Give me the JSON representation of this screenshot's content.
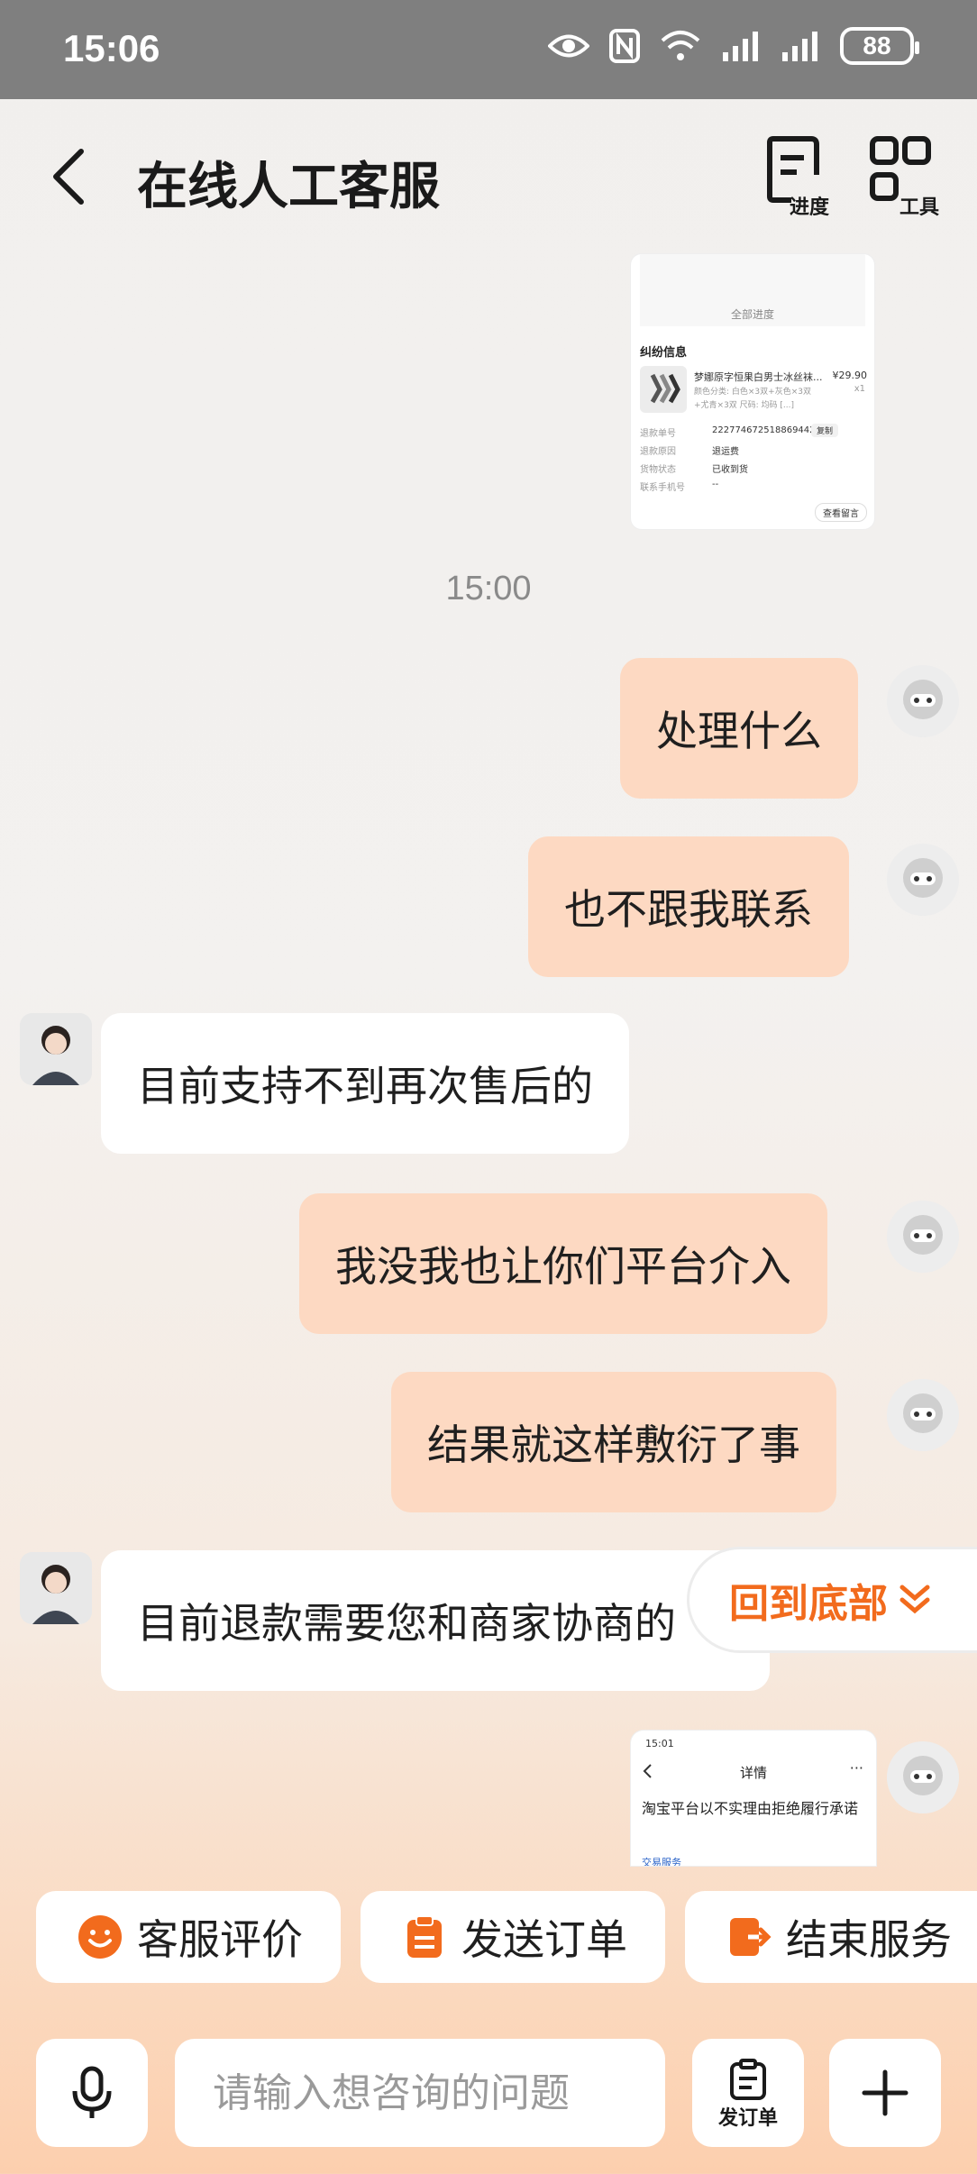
{
  "status_bar": {
    "time": "15:06",
    "battery": "88"
  },
  "header": {
    "title": "在线人工客服",
    "progress_label": "进度",
    "tools_label": "工具"
  },
  "chat": {
    "card1": {
      "all_progress": "全部进度",
      "title": "纠纷信息",
      "product": "梦娜原字恒果白男士冰丝袜...",
      "price": "¥29.90",
      "qty": "x1",
      "variant": "颜色分类: 白色×3双+灰色×3双+尤青×3双 尺码: 均码 [...]",
      "order_no_label": "退款单号",
      "order_no": "2227746725188694421",
      "copy": "复制",
      "reason_label": "退款原因",
      "reason": "退运费",
      "status_label": "货物状态",
      "status": "已收到货",
      "phone_label": "联系手机号",
      "phone": "--",
      "view_msg": "查看留言"
    },
    "time_label": "15:00",
    "messages": [
      {
        "side": "me",
        "text": "处理什么"
      },
      {
        "side": "me",
        "text": "也不跟我联系"
      },
      {
        "side": "them",
        "text": "目前支持不到再次售后的"
      },
      {
        "side": "me",
        "text": "我没我也让你们平台介入"
      },
      {
        "side": "me",
        "text": "结果就这样敷衍了事"
      },
      {
        "side": "them",
        "text": "目前退款需要您和商家协商的"
      }
    ],
    "card2": {
      "time": "15:01",
      "header": "详情",
      "body": "淘宝平台以不实理由拒绝履行承诺",
      "footer": "交易服务"
    }
  },
  "back_to_bottom": "回到底部",
  "quick_actions": [
    {
      "label": "客服评价",
      "icon": "smile-icon"
    },
    {
      "label": "发送订单",
      "icon": "clipboard-icon"
    },
    {
      "label": "结束服务",
      "icon": "exit-icon"
    }
  ],
  "input": {
    "placeholder": "请输入想咨询的问题",
    "order_label": "发订单"
  },
  "colors": {
    "accent": "#f26b1d",
    "my_bubble": "#fdd9c2",
    "their_bubble": "#ffffff"
  }
}
